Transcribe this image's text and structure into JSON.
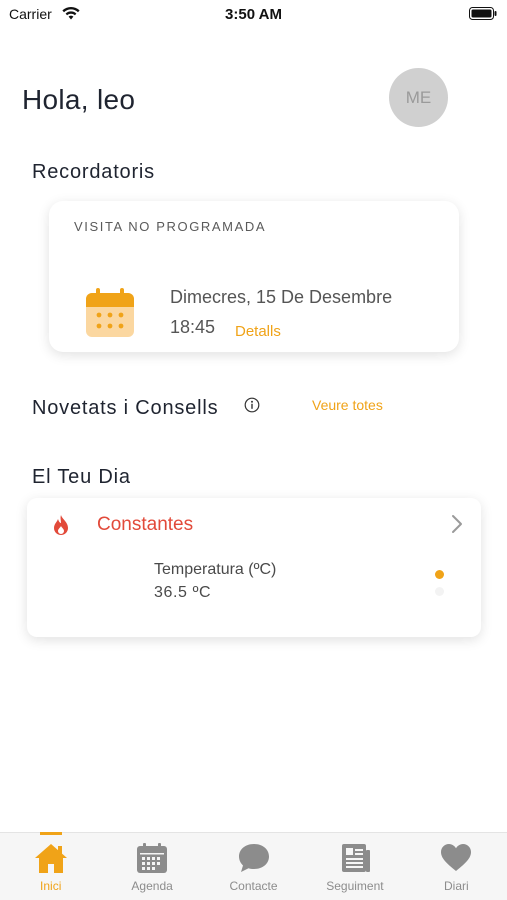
{
  "status_bar": {
    "carrier": "Carrier",
    "time": "3:50 AM"
  },
  "header": {
    "greeting": "Hola, leo",
    "avatar_initials": "ME"
  },
  "reminders": {
    "title": "Recordatoris",
    "card": {
      "type": "VISITA NO PROGRAMADA",
      "date": "Dimecres, 15 De Desembre",
      "time": "18:45",
      "details_link": "Detalls",
      "icon": "calendar-icon"
    }
  },
  "news": {
    "title": "Novetats i Consells",
    "see_all": "Veure totes",
    "info_icon": "info-icon"
  },
  "day": {
    "title": "El Teu Dia",
    "card": {
      "title": "Constantes",
      "icon": "flame-icon",
      "measure_label": "Temperatura (ºC)",
      "measure_value": "36.5 ºC",
      "pager_active_index": 0,
      "pager_count": 2
    }
  },
  "tab_bar": {
    "tabs": [
      {
        "label": "Inici",
        "icon": "home-icon",
        "active": true
      },
      {
        "label": "Agenda",
        "icon": "calendar-grid-icon",
        "active": false
      },
      {
        "label": "Contacte",
        "icon": "chat-bubble-icon",
        "active": false
      },
      {
        "label": "Seguiment",
        "icon": "newspaper-icon",
        "active": false
      },
      {
        "label": "Diari",
        "icon": "heart-icon",
        "active": false
      }
    ]
  },
  "colors": {
    "accent": "#f0a318",
    "alert": "#e24a3a",
    "inactive_tab": "#8c8c8c",
    "avatar_bg": "#d0d0d0"
  }
}
